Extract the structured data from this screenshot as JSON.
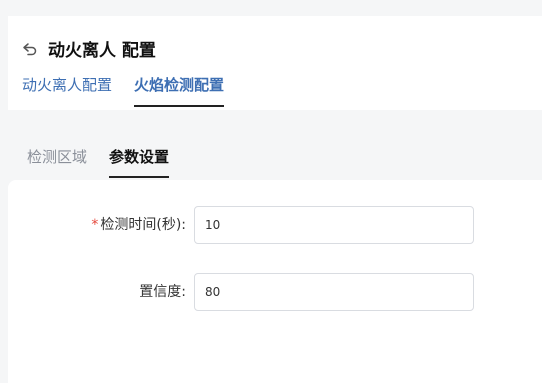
{
  "header": {
    "title": "动火离人 配置",
    "back_icon": "undo-arrow-icon",
    "tabs": [
      {
        "label": "动火离人配置",
        "active": false
      },
      {
        "label": "火焰检测配置",
        "active": true
      }
    ]
  },
  "sub_tabs": [
    {
      "label": "检测区域",
      "active": false
    },
    {
      "label": "参数设置",
      "active": true
    }
  ],
  "form": {
    "fields": [
      {
        "label": "检测时间(秒):",
        "required_mark": "*",
        "value": "10"
      },
      {
        "label": "置信度:",
        "value": "80"
      }
    ]
  },
  "colors": {
    "accent": "#3e6fb3",
    "required": "#e5483c",
    "background": "#f5f6f7"
  }
}
